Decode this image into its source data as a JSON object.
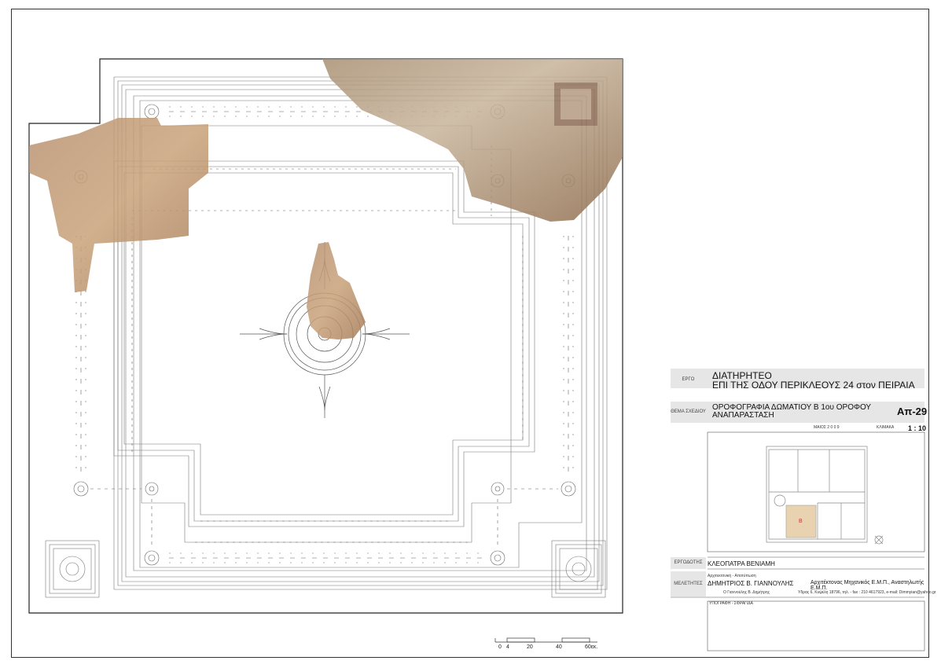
{
  "title_block": {
    "project_label": "ΕΡΓΟ",
    "project_line1": "ΔΙΑΤΗΡΗΤΕΟ",
    "project_line2": "ΕΠΙ ΤΗΣ ΟΔΟΥ ΠΕΡΙΚΛΕΟΥΣ 24 στον ΠΕΙΡΑΙΑ",
    "subject_label": "ΘΕΜΑ ΣΧΕΔΙΟΥ",
    "subject_line1": "ΟΡΟΦΟΓΡΑΦΙΑ ΔΩΜΑΤΙΟΥ  Β  1ου ΟΡΟΦΟΥ",
    "subject_line2": "ΑΝΑΠΑΡΑΣΤΑΣΗ",
    "drawing_code": "Απ-29",
    "date": "ΜΑΙΟΣ  2 0 0 9",
    "scale_label": "ΚΛΙΜΑΚΑ",
    "scale": "1 : 10",
    "room_mark": "Β",
    "client_label": "ΕΡΓΟΔΟΤΗΣ",
    "client": "ΚΛΕΟΠΑΤΡΑ ΒΕΝΙΑΜΗ",
    "designers_label": "ΜΕΛΕΤΗΤΕΣ",
    "study_sub": "Αρχιτεκτονική - Αποτύπωση",
    "designer": "ΔΗΜΗΤΡΙΟΣ Β. ΓΙΑΝΝΟΥΛΗΣ",
    "designer_role": "Αρχιτέκτονας Μηχανικός Ε.Μ.Π., Αναστηλωτής Ε.Μ.Π.",
    "designer_sig_line": "Ο Γιαννούλης Β. Δημήτρης",
    "designer_address": "Υδρας 6, Κυψέλη 18796, τηλ. - fax : 210 4617923, e-mail: Dimmyian@yahoo.gr",
    "signature_label": "ΥΠΟΓΡΑΦΗ - ΣΦΡΑΓΙΔΑ"
  },
  "scale_bar": {
    "labels": [
      "0",
      "4",
      "20",
      "40",
      "60εκ."
    ]
  },
  "colors": {
    "line": "#555555",
    "fresco_light": "#c9a27a",
    "fresco_dark": "#8a6240",
    "title_bg": "#e6e6e6",
    "room_highlight": "#e8d2b0"
  }
}
